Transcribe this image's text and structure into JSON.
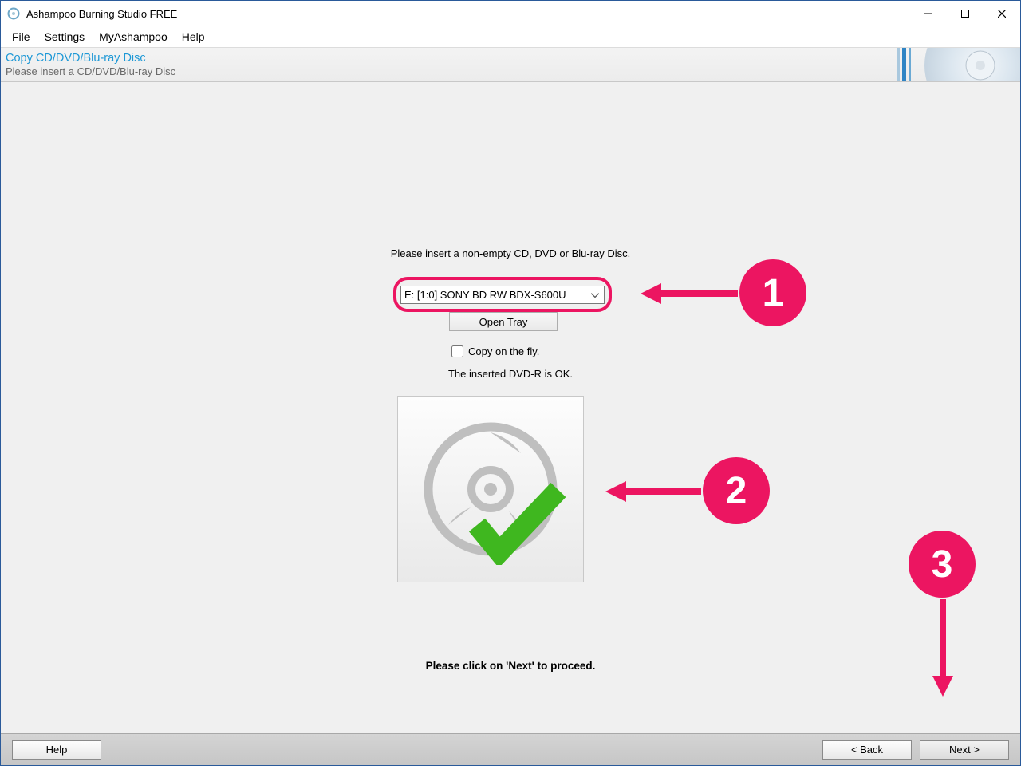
{
  "window": {
    "title": "Ashampoo Burning Studio FREE"
  },
  "menu": {
    "file": "File",
    "settings": "Settings",
    "myashampoo": "MyAshampoo",
    "help": "Help"
  },
  "header": {
    "title": "Copy CD/DVD/Blu-ray Disc",
    "subtitle": "Please insert a CD/DVD/Blu-ray Disc"
  },
  "main": {
    "instruction": "Please insert a non-empty CD, DVD or Blu-ray Disc.",
    "drive_selected": "E: [1:0] SONY   BD RW BDX-S600U",
    "open_tray_label": "Open Tray",
    "copy_on_fly_label": "Copy on the fly.",
    "copy_on_fly_checked": false,
    "status": "The inserted DVD-R is OK.",
    "proceed": "Please click on 'Next' to proceed."
  },
  "footer": {
    "help": "Help",
    "back": "< Back",
    "next": "Next >"
  },
  "annotations": {
    "c1": "1",
    "c2": "2",
    "c3": "3",
    "color": "#ec1561"
  }
}
